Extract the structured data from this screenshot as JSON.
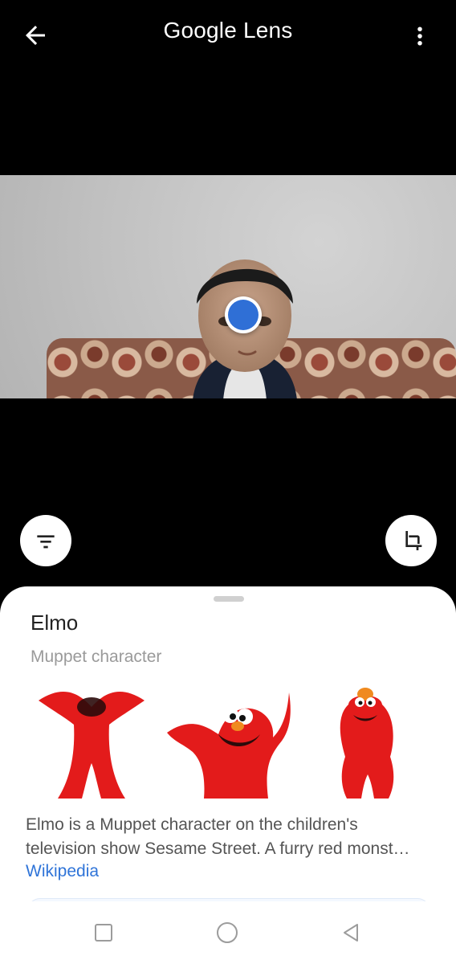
{
  "header": {
    "title": "Google Lens"
  },
  "result": {
    "title": "Elmo",
    "subtitle": "Muppet character",
    "description": "Elmo is a Muppet character on the children's television show Sesame Street. A furry red monst…",
    "source": "Wikipedia"
  },
  "icons": {
    "back": "arrow-left",
    "more": "more-vert",
    "filter": "filter-list",
    "crop": "crop",
    "nav_recent": "square",
    "nav_home": "circle",
    "nav_back": "triangle-left"
  },
  "colors": {
    "accent": "#2f6fd6",
    "link": "#2f74d8",
    "elmo_red": "#e31b1b"
  }
}
